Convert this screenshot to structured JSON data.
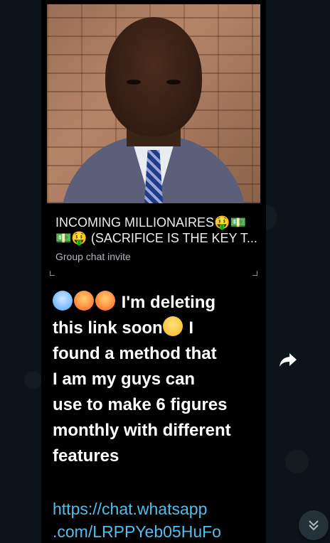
{
  "preview": {
    "title_line1": "INCOMING MILLIONAIRES🤑💵",
    "title_line2": "💵🤑 (SACRIFICE IS THE KEY T...",
    "subtitle": "Group chat invite"
  },
  "message": {
    "line1": "I'm deleting",
    "line2a": "this link soon",
    "line2b": " I",
    "rest": "found a method that\nI am my guys can\nuse to make 6 figures\nmonthly with different\nfeatures"
  },
  "link": {
    "line1": "https://chat.whatsapp",
    "line2": ".com/LRPPYeb05HuFo"
  },
  "icons": {
    "forward": "forward-arrow-icon",
    "scroll": "double-chevron-down-icon"
  }
}
